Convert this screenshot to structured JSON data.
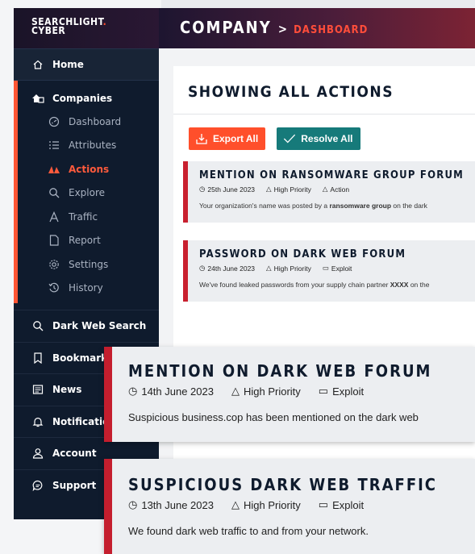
{
  "logo": {
    "line1": "SEARCHLIGHT",
    "dot": ".",
    "line2": "CYBER"
  },
  "breadcrumb": {
    "company": "COMPANY",
    "separator": ">",
    "page": "DASHBOARD"
  },
  "nav": {
    "home": "Home",
    "companies": "Companies",
    "sub_items": [
      {
        "label": "Dashboard",
        "icon": "dashboard-icon"
      },
      {
        "label": "Attributes",
        "icon": "list-icon"
      },
      {
        "label": "Actions",
        "icon": "actions-icon",
        "active": true
      },
      {
        "label": "Explore",
        "icon": "search-icon"
      },
      {
        "label": "Traffic",
        "icon": "traffic-icon"
      },
      {
        "label": "Report",
        "icon": "report-icon"
      },
      {
        "label": "Settings",
        "icon": "gear-icon"
      },
      {
        "label": "History",
        "icon": "history-icon"
      }
    ],
    "main_items": [
      {
        "label": "Dark Web Search",
        "icon": "search-icon"
      },
      {
        "label": "Bookmarks",
        "icon": "bookmark-icon"
      },
      {
        "label": "News",
        "icon": "news-icon"
      },
      {
        "label": "Notifications",
        "icon": "bell-icon"
      },
      {
        "label": "Account",
        "icon": "user-icon"
      },
      {
        "label": "Support",
        "icon": "chat-icon"
      }
    ]
  },
  "content": {
    "title": "SHOWING ALL ACTIONS",
    "export_label": "Export All",
    "resolve_label": "Resolve All",
    "actions": [
      {
        "title": "MENTION ON RANSOMWARE GROUP FORUM",
        "date": "25th June 2023",
        "priority": "High Priority",
        "type": "Action",
        "desc_pre": "Your organization's name was posted by a ",
        "desc_bold": "ransomware group",
        "desc_post": " on the dark"
      },
      {
        "title": "PASSWORD ON DARK WEB FORUM",
        "date": "24th June 2023",
        "priority": "High Priority",
        "type": "Exploit",
        "desc_pre": "We've found leaked passwords from your supply chain partner ",
        "desc_bold": "XXXX",
        "desc_post": " on the"
      }
    ]
  },
  "floating_cards": [
    {
      "title": "MENTION ON DARK WEB FORUM",
      "date": "14th June 2023",
      "priority": "High Priority",
      "type": "Exploit",
      "desc": "Suspicious business.cop has been mentioned on the dark web"
    },
    {
      "title": "SUSPICIOUS DARK WEB TRAFFIC",
      "date": "13th June 2023",
      "priority": "High Priority",
      "type": "Exploit",
      "desc": "We found dark web traffic to and from your network."
    }
  ],
  "colors": {
    "accent": "#ff4f2b",
    "teal": "#167a7a",
    "navy": "#0f1b2d",
    "alert_red": "#c41e2e"
  }
}
